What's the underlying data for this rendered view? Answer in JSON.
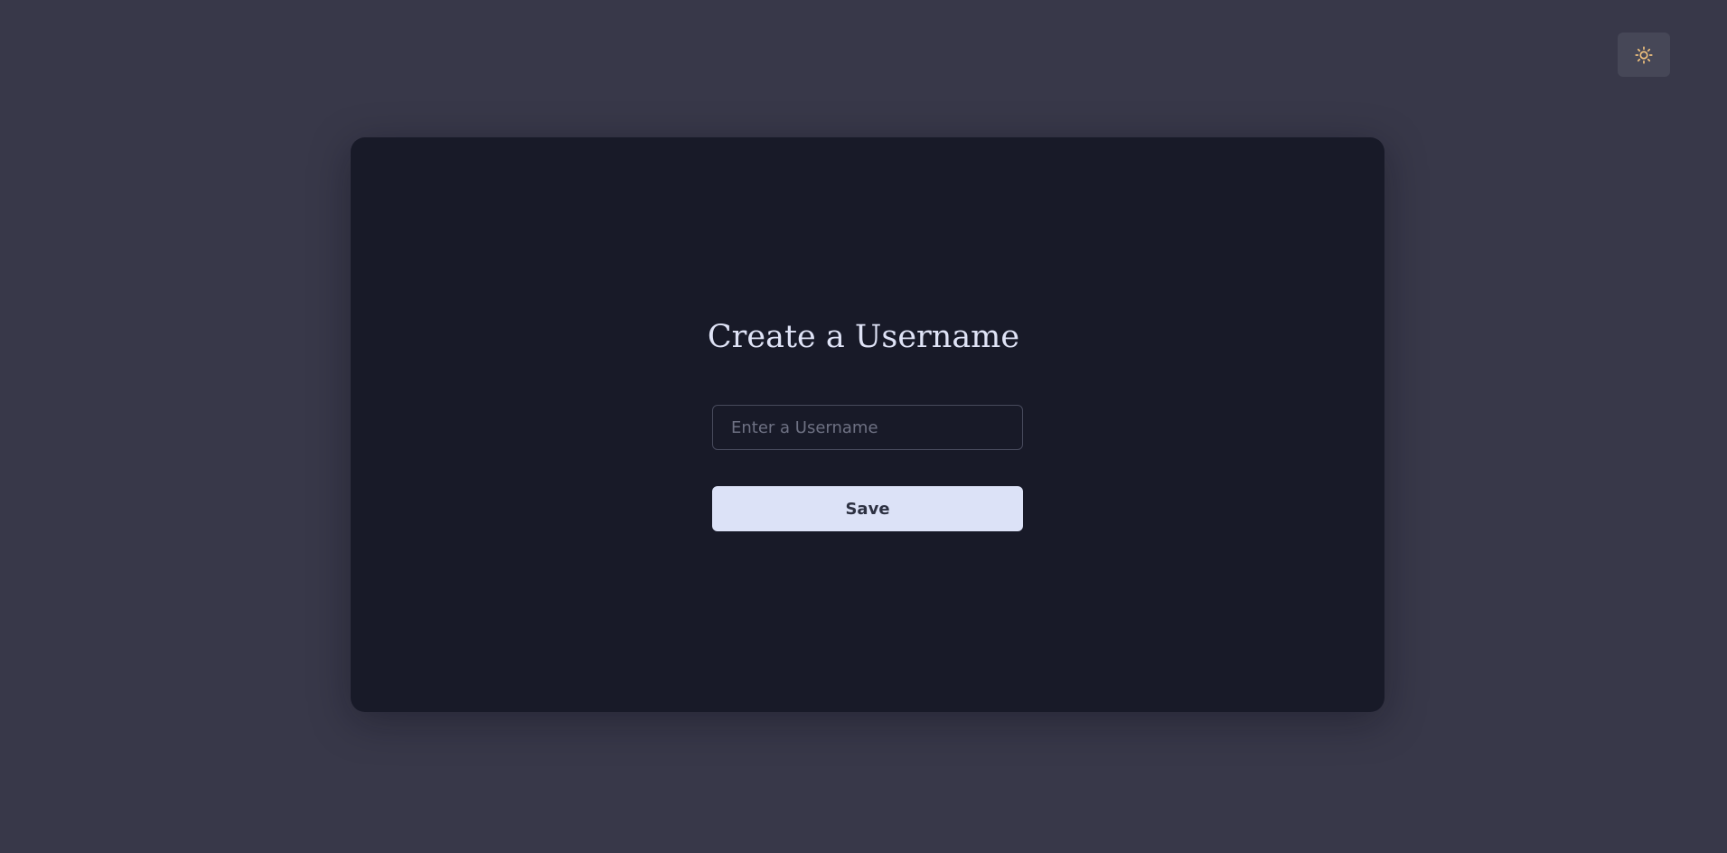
{
  "theme_toggle": {
    "icon": "sun-icon",
    "color": "#f1c27d"
  },
  "username_form": {
    "title": "Create a Username",
    "input_placeholder": "Enter a Username",
    "input_value": "",
    "save_label": "Save"
  },
  "colors": {
    "background": "#383849",
    "card": "#181a28",
    "button": "#dce2f7"
  }
}
